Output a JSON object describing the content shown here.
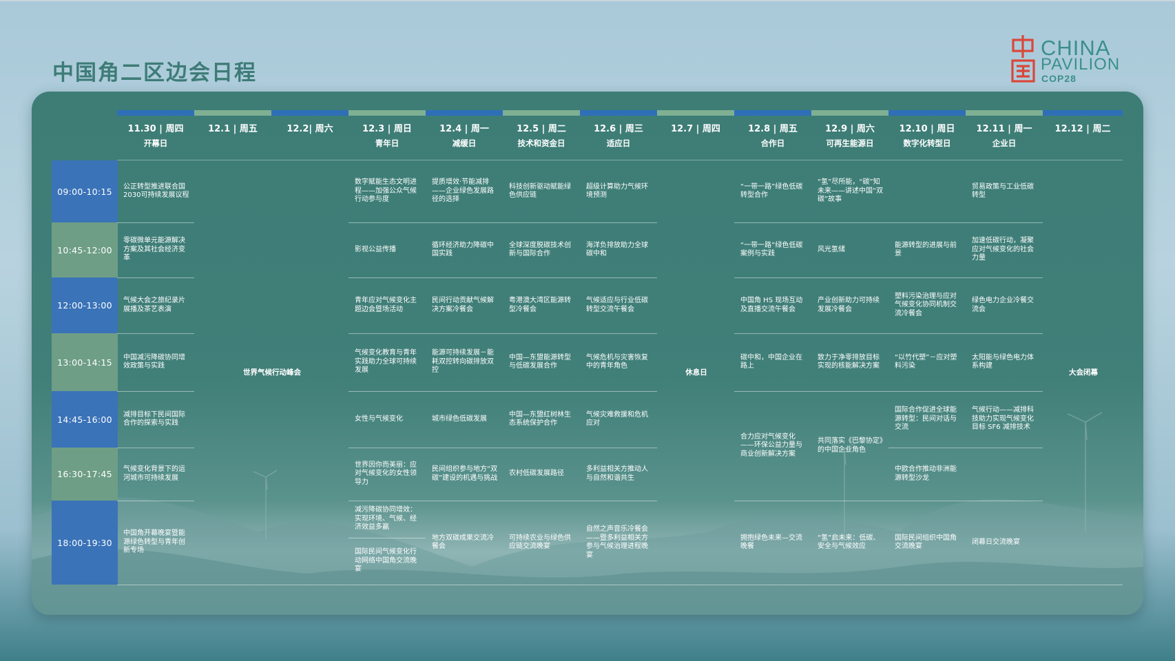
{
  "page": {
    "title": "中国角二区边会日程"
  },
  "logo": {
    "mark": "中国",
    "line1": "CHINA",
    "line2": "PAVILION",
    "line3": "COP28",
    "colors": {
      "mark": "#d9473a",
      "text": "#3b8f8a"
    }
  },
  "colors": {
    "panel": "#3d7d76",
    "time_blue": "#3a73b8",
    "time_green": "#6e9e86",
    "bar_blue": "#2f6fb8",
    "bar_green": "#7fb092"
  },
  "columns": [
    {
      "date": "11.30 | 周四",
      "theme": "开幕日"
    },
    {
      "date": "12.1 | 周五",
      "theme": ""
    },
    {
      "date": "12.2| 周六",
      "theme": ""
    },
    {
      "date": "12.3 | 周日",
      "theme": "青年日"
    },
    {
      "date": "12.4 | 周一",
      "theme": "减缓日"
    },
    {
      "date": "12.5 | 周二",
      "theme": "技术和资金日"
    },
    {
      "date": "12.6 | 周三",
      "theme": "适应日"
    },
    {
      "date": "12.7 | 周四",
      "theme": ""
    },
    {
      "date": "12.8 | 周五",
      "theme": "合作日"
    },
    {
      "date": "12.9 | 周六",
      "theme": "可再生能源日"
    },
    {
      "date": "12.10 | 周日",
      "theme": "数字化转型日"
    },
    {
      "date": "12.11 | 周一",
      "theme": "企业日"
    },
    {
      "date": "12.12 | 周二",
      "theme": ""
    }
  ],
  "times": [
    "09:00-10:15",
    "10:45-12:00",
    "12:00-13:00",
    "13:00-14:15",
    "14:45-16:00",
    "16:30-17:45",
    "18:00-19:30"
  ],
  "merged": {
    "dec1_2": "世界气候行动峰会",
    "dec7": "休息日",
    "dec12": "大会闭幕"
  },
  "sessions": {
    "c1130": [
      "公正转型推进联合国2030可持续发展议程",
      "零碳微单元能源解决方案及其社会经济变革",
      "气候大会之旅纪录片展播及茶艺表演",
      "中国减污降碳协同增效政策与实践",
      "减排目标下民间国际合作的探索与实践",
      "气候变化背景下的运河城市可持续发展",
      "中国角开幕晚宴暨能源绿色转型与青年创新专场"
    ],
    "c1203": [
      "数字赋能生态文明进程——加强公众气候行动参与度",
      "影视公益传播",
      "青年应对气候变化主题边会暨场活动",
      "气候变化教育与青年实践助力全球可持续发展",
      "女性与气候变化",
      "世界因你而美丽：应对气候变化的女性领导力",
      "减污降碳协同增效：实现环境、气候、经济效益多赢",
      "国际民间气候变化行动网络中国角交流晚宴"
    ],
    "c1204": [
      "提质增效·节能减排——企业绿色发展路径的选择",
      "循环经济助力降碳中国实践",
      "民间行动贡献气候解决方案冷餐会",
      "能源可持续发展－能耗双控转向碳排放双控",
      "城市绿色低碳发展",
      "民间组织参与地方“双碳”建设的机遇与挑战",
      "地方双碳成果交流冷餐会"
    ],
    "c1205": [
      "科技创新驱动赋能绿色供应链",
      "全球深度脱碳技术创新与国际合作",
      "粤港澳大湾区能源转型冷餐会",
      "中国—东盟能源转型与低碳发展合作",
      "中国—东盟红树林生态系统保护合作",
      "农村低碳发展路径",
      "可持续农业与绿色供应链交流晚宴"
    ],
    "c1206": [
      "超级计算助力气候环境预测",
      "海洋负排放助力全球碳中和",
      "气候适应与行业低碳转型交流午餐会",
      "气候危机与灾害恢复中的青年角色",
      "气候灾难救援和危机应对",
      "多利益相关方推动人与自然和谐共生",
      "自然之声音乐冷餐会——暨多利益相关方参与气候治理进程晚宴"
    ],
    "c1208": [
      "“一带一路”绿色低碳转型合作",
      "“一带一路”绿色低碳案例与实践",
      "中国角 HS 现场互动及直播交流午餐会",
      "碳中和，中国企业在路上",
      "合力应对气候变化——环保公益力量与商业创新解决方案",
      "拥抱绿色未来—交流晚餐"
    ],
    "c1209": [
      "“氢”尽所能，“碳”知未来——讲述中国“双碳”故事",
      "风光氢储",
      "产业创新助力可持续发展冷餐会",
      "致力于净零排放目标实现的核能解决方案",
      "共同落实《巴黎协定》的中国企业角色",
      "“氢”启未来：低碳、安全与气候效应"
    ],
    "c1210": [
      "",
      "能源转型的进展与前景",
      "塑料污染治理与应对气候变化协同机制交流冷餐会",
      "“以竹代塑”－应对塑料污染",
      "国际合作促进全球能源转型：民间对话与交流",
      "中欧合作推动非洲能源转型沙龙",
      "国际民间组织中国角交流晚宴"
    ],
    "c1211": [
      "贸易政策与工业低碳转型",
      "加速低碳行动，凝聚应对气候变化的社会力量",
      "绿色电力企业冷餐交流会",
      "太阳能与绿色电力体系构建",
      "气候行动——减排科技助力实现气候变化目标 SF6 减排技术",
      "",
      "闭幕日交流晚宴"
    ]
  }
}
